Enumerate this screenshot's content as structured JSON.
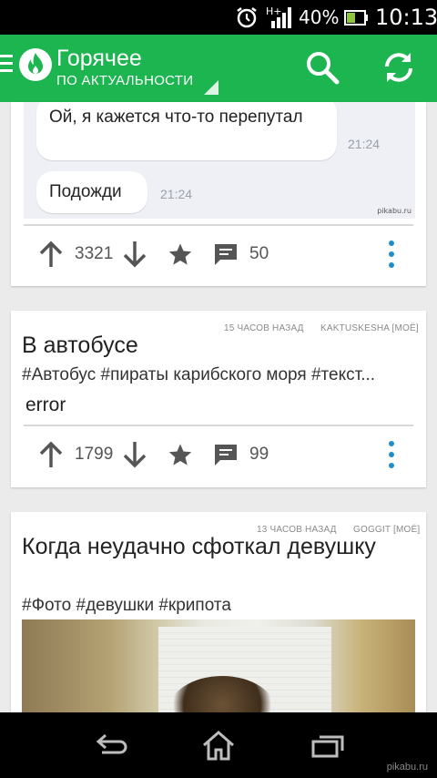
{
  "status_bar": {
    "network": "H+",
    "battery_percent": "40%",
    "time": "10:13",
    "icons": [
      "alarm-icon",
      "signal-icon",
      "battery-icon"
    ]
  },
  "app_bar": {
    "title": "Горячее",
    "subtitle": "ПО АКТУАЛЬНОСТИ",
    "accent_color": "#1cb550",
    "icons": [
      "menu-icon",
      "fire-logo-icon",
      "search-icon",
      "refresh-icon"
    ]
  },
  "posts": [
    {
      "chat": {
        "message1": "Ой, я кажется что-то перепутал",
        "time1": "21:24",
        "message2": "Подожди",
        "time2": "21:24",
        "watermark": "pikabu.ru"
      },
      "score": "3321",
      "comments": "50"
    },
    {
      "time_ago": "15 ЧАСОВ НАЗАД",
      "author": "KAKTUSKESHA [МОЁ]",
      "title": "В автобусе",
      "tags": "#Автобус #пираты карибского моря #текст...",
      "body": "error",
      "score": "1799",
      "comments": "99"
    },
    {
      "time_ago": "13 ЧАСОВ НАЗАД",
      "author": "GOGGIT [МОЁ]",
      "title": "Когда неудачно сфоткал девушку",
      "tags": "#Фото #девушки #крипота"
    }
  ],
  "nav_bar": {
    "watermark": "pikabu.ru",
    "icons": [
      "back-icon",
      "home-icon",
      "recent-apps-icon"
    ]
  }
}
